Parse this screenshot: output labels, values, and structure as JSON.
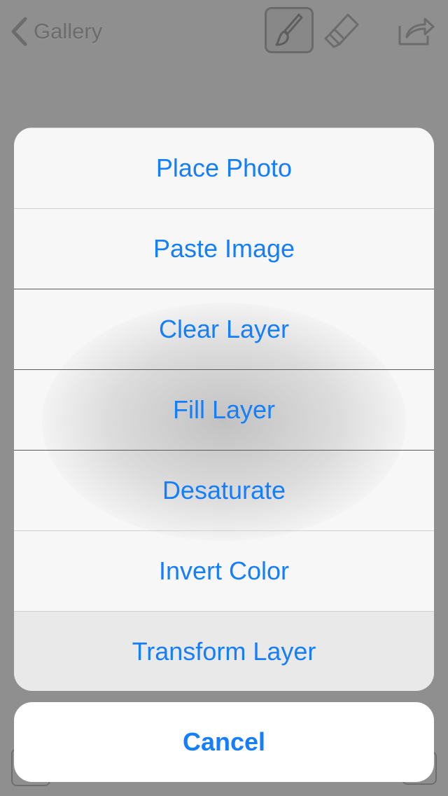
{
  "toolbar": {
    "back_label": "Gallery",
    "back_icon": "chevron-left-icon",
    "tools": [
      {
        "name": "brush",
        "icon": "brush-icon",
        "selected": true
      },
      {
        "name": "eraser",
        "icon": "eraser-icon",
        "selected": false
      },
      {
        "name": "share",
        "icon": "share-icon",
        "selected": false
      }
    ]
  },
  "action_sheet": {
    "actions": [
      {
        "label": "Place Photo"
      },
      {
        "label": "Paste Image"
      },
      {
        "label": "Clear Layer"
      },
      {
        "label": "Fill Layer"
      },
      {
        "label": "Desaturate"
      },
      {
        "label": "Invert Color"
      },
      {
        "label": "Transform Layer",
        "highlighted": true
      }
    ],
    "cancel_label": "Cancel"
  },
  "colors": {
    "accent": "#157efb",
    "dim_background": "#8f8f8f",
    "sheet_background": "#f7f7f7"
  }
}
